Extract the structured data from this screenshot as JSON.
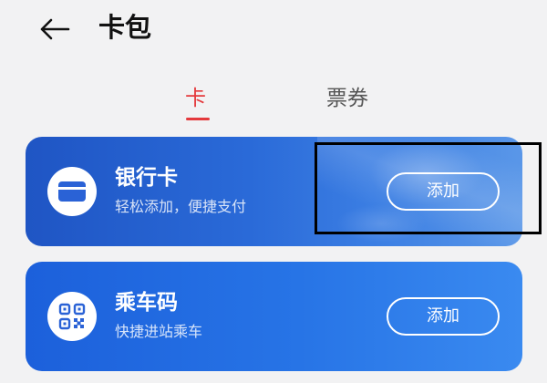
{
  "header": {
    "title": "卡包",
    "back_icon": "arrow-left-icon"
  },
  "tabs": [
    {
      "label": "卡",
      "active": true
    },
    {
      "label": "票券",
      "active": false
    }
  ],
  "cards": [
    {
      "title": "银行卡",
      "subtitle": "轻松添加，便捷支付",
      "button_label": "添加",
      "icon": "bank-card-icon"
    },
    {
      "title": "乘车码",
      "subtitle": "快捷进站乘车",
      "button_label": "添加",
      "icon": "qr-code-icon"
    }
  ],
  "colors": {
    "accent": "#e4393c",
    "card_blue": "#2a6ad8",
    "background": "#f2f2f3"
  }
}
